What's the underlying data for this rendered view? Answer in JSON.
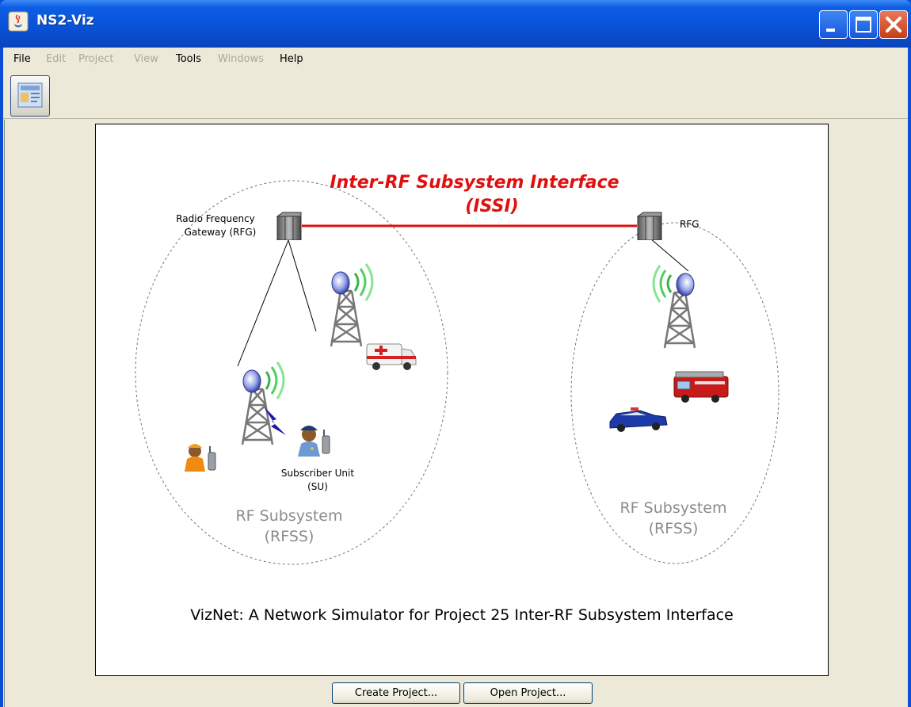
{
  "window": {
    "title": "NS2-Viz",
    "colors": {
      "titlebar": "#0a52d8",
      "close": "#c73d15",
      "client": "#ece9d8"
    }
  },
  "menubar": {
    "items": [
      {
        "label": "File",
        "enabled": true
      },
      {
        "label": "Edit",
        "enabled": false
      },
      {
        "label": "Project",
        "enabled": false
      },
      {
        "label": "View",
        "enabled": false
      },
      {
        "label": "Tools",
        "enabled": true
      },
      {
        "label": "Windows",
        "enabled": false
      },
      {
        "label": "Help",
        "enabled": true
      }
    ]
  },
  "toolbar": {
    "icon": "new-project-icon"
  },
  "diagram": {
    "issi_title": "Inter-RF Subsystem Interface",
    "issi_abbr": "(ISSI)",
    "rfg_left_line1": "Radio Frequency",
    "rfg_left_line2": "Gateway (RFG)",
    "rfg_right": "RFG",
    "su_line1": "Subscriber Unit",
    "su_line2": "(SU)",
    "rfss_left_line1": "RF Subsystem",
    "rfss_left_line2": "(RFSS)",
    "rfss_right_line1": "RF Subsystem",
    "rfss_right_line2": "(RFSS)",
    "caption": "VizNet: A Network Simulator for Project 25 Inter-RF Subsystem Interface",
    "colors": {
      "issi": "#e01010",
      "rfss_label": "#8c8c8c"
    }
  },
  "buttons": {
    "create": "Create Project...",
    "open": "Open Project..."
  }
}
